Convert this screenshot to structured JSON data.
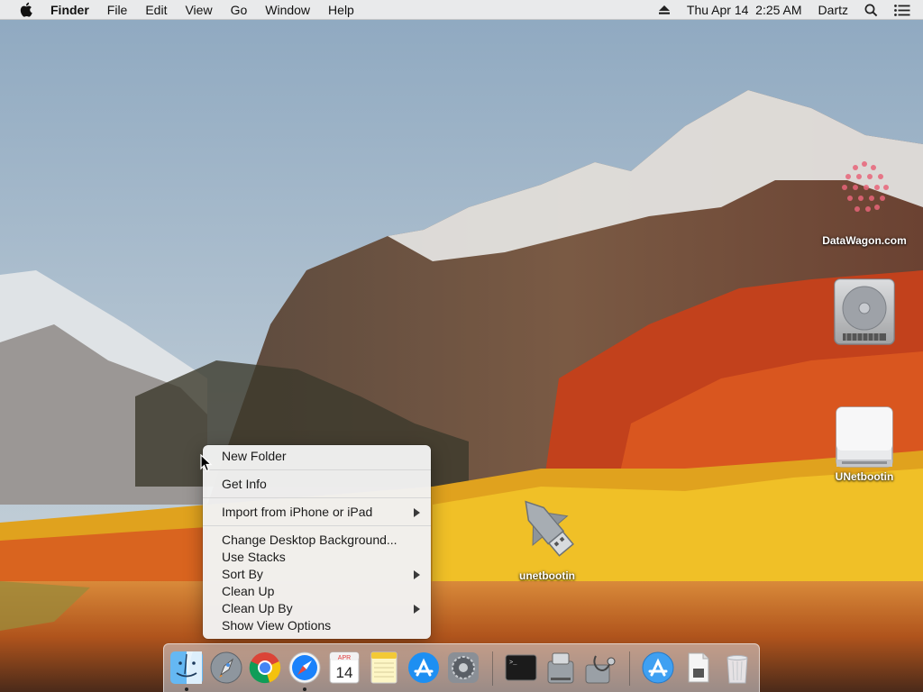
{
  "menubar": {
    "app_name": "Finder",
    "menus": [
      "File",
      "Edit",
      "View",
      "Go",
      "Window",
      "Help"
    ],
    "clock": "Thu Apr 14  2:25 AM",
    "user": "Dartz",
    "icons": [
      "apple-icon",
      "eject-icon",
      "spotlight-search-icon",
      "notification-center-icon"
    ]
  },
  "desktop": {
    "icons": [
      {
        "label": "DataWagon.com",
        "icon": "datawagon-logo-icon"
      },
      {
        "label": "",
        "icon": "hard-drive-icon"
      },
      {
        "label": "UNetbootin",
        "icon": "external-drive-icon"
      },
      {
        "label": "unetbootin",
        "icon": "unetbootin-app-icon"
      }
    ]
  },
  "context_menu": {
    "items": [
      {
        "label": "New Folder"
      },
      {
        "label": "Get Info"
      },
      {
        "label": "Import from iPhone or iPad",
        "submenu": true
      },
      {
        "label": "Change Desktop Background..."
      },
      {
        "label": "Use Stacks"
      },
      {
        "label": "Sort By",
        "submenu": true
      },
      {
        "label": "Clean Up"
      },
      {
        "label": "Clean Up By",
        "submenu": true
      },
      {
        "label": "Show View Options"
      }
    ]
  },
  "dock": {
    "apps": [
      {
        "name": "finder-icon",
        "running": true
      },
      {
        "name": "launchpad-icon",
        "running": false
      },
      {
        "name": "chrome-icon",
        "running": false
      },
      {
        "name": "safari-icon",
        "running": true
      },
      {
        "name": "calendar-icon",
        "running": false,
        "month": "APR",
        "day": "14"
      },
      {
        "name": "notes-icon",
        "running": false
      },
      {
        "name": "app-store-icon",
        "running": false
      },
      {
        "name": "system-preferences-icon",
        "running": false
      },
      {
        "name": "terminal-icon",
        "running": false
      },
      {
        "name": "disk-utility-icon",
        "running": false
      },
      {
        "name": "disk-utility-stethoscope-icon",
        "running": false
      },
      {
        "name": "app-store-downloads-icon",
        "running": false
      },
      {
        "name": "documents-icon",
        "running": false
      },
      {
        "name": "trash-icon",
        "running": false
      }
    ]
  },
  "colors": {
    "menubar_bg": "#ececec",
    "menu_bg": "#f2f2f2",
    "accent_blue": "#1a82fb"
  }
}
